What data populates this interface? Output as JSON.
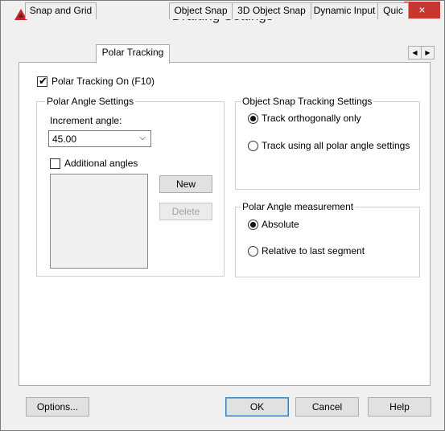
{
  "window": {
    "title": "Drafting Settings",
    "close_label": "×"
  },
  "tabs": [
    {
      "label": "Snap and Grid",
      "active": false
    },
    {
      "label": "Polar Tracking",
      "active": true
    },
    {
      "label": "Object Snap",
      "active": false
    },
    {
      "label": "3D Object Snap",
      "active": false
    },
    {
      "label": "Dynamic Input",
      "active": false
    },
    {
      "label": "Quic",
      "active": false
    }
  ],
  "tab_scroll": {
    "left": "◀",
    "right": "▶"
  },
  "polar_tracking": {
    "toggle_label": "Polar Tracking On (F10)",
    "checked": true
  },
  "polar_angle_settings": {
    "title": "Polar Angle Settings",
    "increment_label": "Increment angle:",
    "increment_value": "45.00",
    "additional_label": "Additional angles",
    "additional_checked": false,
    "new_button": "New",
    "delete_button": "Delete"
  },
  "object_snap_tracking": {
    "title": "Object Snap Tracking Settings",
    "options": [
      {
        "label": "Track orthogonally only",
        "selected": true
      },
      {
        "label": "Track using all polar angle settings",
        "selected": false
      }
    ]
  },
  "polar_angle_measurement": {
    "title": "Polar Angle measurement",
    "options": [
      {
        "label": "Absolute",
        "selected": true
      },
      {
        "label": "Relative to last segment",
        "selected": false
      }
    ]
  },
  "footer": {
    "options_button": "Options...",
    "ok_button": "OK",
    "cancel_button": "Cancel",
    "help_button": "Help"
  },
  "icons": {
    "check": "✔",
    "dropdown": "⌵"
  },
  "colors": {
    "close_button": "#c7372f",
    "app_icon": "#c0282d"
  }
}
